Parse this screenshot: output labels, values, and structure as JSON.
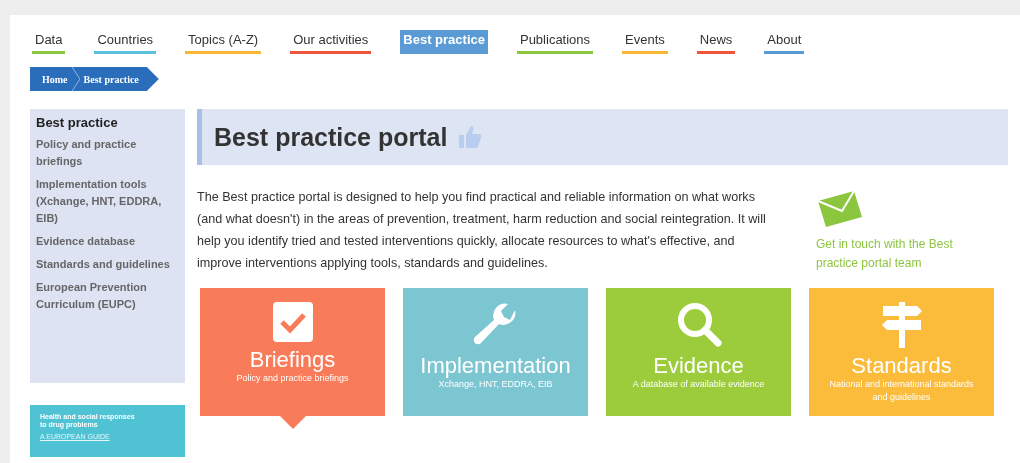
{
  "nav": [
    {
      "label": "Data",
      "color": "#8cc63f",
      "selected": false
    },
    {
      "label": "Countries",
      "color": "#5bc0de",
      "selected": false
    },
    {
      "label": "Topics (A-Z)",
      "color": "#f7b731",
      "selected": false
    },
    {
      "label": "Our activities",
      "color": "#f0543c",
      "selected": false
    },
    {
      "label": "Best practice",
      "color": "#5b9bd5",
      "selected": true
    },
    {
      "label": "Publications",
      "color": "#8cc63f",
      "selected": false
    },
    {
      "label": "Events",
      "color": "#f7b731",
      "selected": false
    },
    {
      "label": "News",
      "color": "#f0543c",
      "selected": false
    },
    {
      "label": "About",
      "color": "#5b9bd5",
      "selected": false
    }
  ],
  "breadcrumb": [
    "Home",
    "Best practice"
  ],
  "sidebar": {
    "heading": "Best practice",
    "items": [
      "Policy and practice briefings",
      "Implementation tools (Xchange, HNT, EDDRA, EIB)",
      "Evidence database",
      "Standards and guidelines",
      "European Prevention Curriculum (EUPC)"
    ]
  },
  "banner": {
    "title": "Health and social responses to drug problems",
    "link": "A EUROPEAN GUIDE"
  },
  "page_title": "Best practice portal",
  "intro": "The Best practice portal is designed to help you find practical and reliable information on what works (and what doesn't) in the areas of prevention, treatment, harm reduction and social reintegration. It will help you identify tried and tested interventions quickly, allocate resources to what's effective, and improve interventions applying tools, standards and guidelines.",
  "contact": "Get in touch with the Best practice portal team",
  "tiles": [
    {
      "kind": "check",
      "title": "Briefings",
      "subtitle": "Policy and practice briefings",
      "color": "#f97c5a",
      "selected": true
    },
    {
      "kind": "wrench",
      "title": "Implementation",
      "subtitle": "Xchange, HNT, EDDRA, EIB",
      "color": "#7cc6d2",
      "selected": false
    },
    {
      "kind": "search",
      "title": "Evidence",
      "subtitle": "A database of available evidence",
      "color": "#9ccc3c",
      "selected": false
    },
    {
      "kind": "signpost",
      "title": "Standards",
      "subtitle": "National and international standards and guidelines",
      "color": "#fbbc3b",
      "selected": false
    }
  ]
}
